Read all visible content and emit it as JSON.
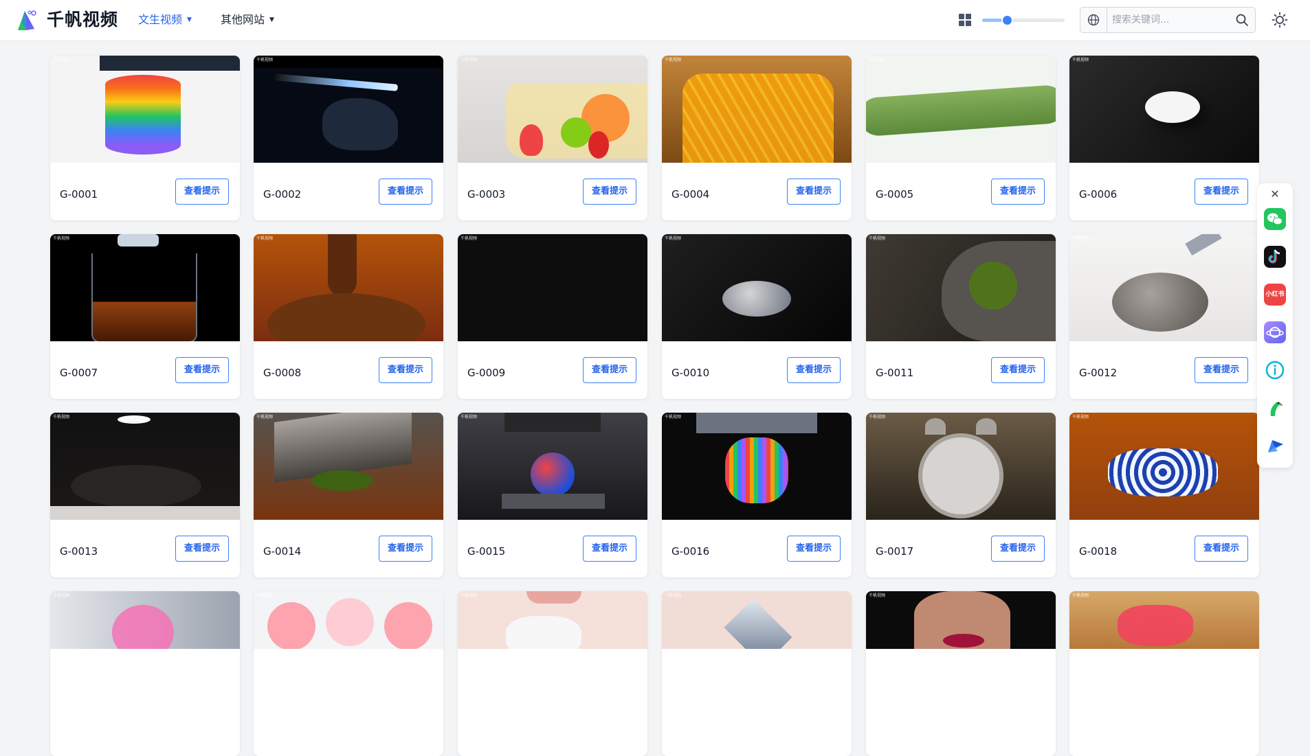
{
  "header": {
    "brand": "千帆视频",
    "nav": [
      {
        "label": "文生视频",
        "active": true
      },
      {
        "label": "其他网站",
        "active": false
      }
    ],
    "zoom_slider_value": 0.3,
    "search_placeholder": "搜索关键词...",
    "search_value": ""
  },
  "icons": {
    "logo": "sail-logo-icon",
    "grid": "grid-view-icon",
    "globe": "globe-icon",
    "search": "search-icon",
    "theme": "sun-icon",
    "close": "close-icon",
    "social": [
      "wechat-icon",
      "douyin-icon",
      "xiaohongshu-icon",
      "planet-app-icon",
      "info-icon",
      "parrot-icon",
      "feishu-icon"
    ]
  },
  "social": {
    "close_label": "✕",
    "xiaohongshu_label": "小红书"
  },
  "button_label": "查看提示",
  "watermark": "千帆视频",
  "cards": [
    {
      "id": "G-0001"
    },
    {
      "id": "G-0002"
    },
    {
      "id": "G-0003"
    },
    {
      "id": "G-0004"
    },
    {
      "id": "G-0005"
    },
    {
      "id": "G-0006"
    },
    {
      "id": "G-0007"
    },
    {
      "id": "G-0008"
    },
    {
      "id": "G-0009"
    },
    {
      "id": "G-0010"
    },
    {
      "id": "G-0011"
    },
    {
      "id": "G-0012"
    },
    {
      "id": "G-0013"
    },
    {
      "id": "G-0014"
    },
    {
      "id": "G-0015"
    },
    {
      "id": "G-0016"
    },
    {
      "id": "G-0017"
    },
    {
      "id": "G-0018"
    }
  ],
  "colors": {
    "accent": "#2563eb",
    "page_bg": "#f3f4f6",
    "card_bg": "#ffffff"
  }
}
